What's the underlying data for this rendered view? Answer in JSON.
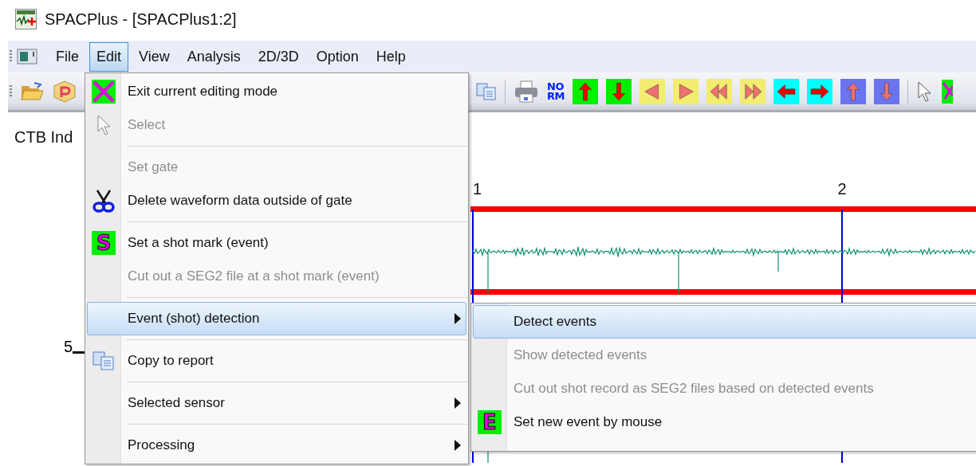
{
  "window": {
    "title": "SPACPlus - [SPACPlus1:2]"
  },
  "menu_bar": [
    {
      "label": "File",
      "selected": false
    },
    {
      "label": "Edit",
      "selected": true
    },
    {
      "label": "View",
      "selected": false
    },
    {
      "label": "Analysis",
      "selected": false
    },
    {
      "label": "2D/3D",
      "selected": false
    },
    {
      "label": "Option",
      "selected": false
    },
    {
      "label": "Help",
      "selected": false
    }
  ],
  "toolbar": {
    "norm_button_text": [
      "NO",
      "RM"
    ]
  },
  "content": {
    "heading": "CTB Ind",
    "trace_number": "5"
  },
  "plot": {
    "trace_labels": [
      "1",
      "2"
    ]
  },
  "edit_menu": [
    {
      "kind": "item",
      "label": "Exit current editing mode",
      "disabled": false,
      "selected": false,
      "has_submenu": false
    },
    {
      "kind": "item",
      "label": "Select",
      "disabled": true,
      "selected": false,
      "has_submenu": false
    },
    {
      "kind": "separator"
    },
    {
      "kind": "item",
      "label": "Set gate",
      "disabled": true,
      "selected": false,
      "has_submenu": false
    },
    {
      "kind": "item",
      "label": "Delete waveform data outside of gate",
      "disabled": false,
      "selected": false,
      "has_submenu": false
    },
    {
      "kind": "separator"
    },
    {
      "kind": "item",
      "label": "Set a shot mark (event)",
      "disabled": false,
      "selected": false,
      "has_submenu": false,
      "icon_text": "S"
    },
    {
      "kind": "item",
      "label": "Cut out a SEG2 file at a shot mark (event)",
      "disabled": true,
      "selected": false,
      "has_submenu": false
    },
    {
      "kind": "separator"
    },
    {
      "kind": "item",
      "label": "Event (shot) detection",
      "disabled": false,
      "selected": true,
      "has_submenu": true
    },
    {
      "kind": "separator"
    },
    {
      "kind": "item",
      "label": "Copy to report",
      "disabled": false,
      "selected": false,
      "has_submenu": false
    },
    {
      "kind": "separator"
    },
    {
      "kind": "item",
      "label": "Selected sensor",
      "disabled": false,
      "selected": false,
      "has_submenu": true
    },
    {
      "kind": "separator"
    },
    {
      "kind": "item",
      "label": "Processing",
      "disabled": false,
      "selected": false,
      "has_submenu": true
    }
  ],
  "submenu": [
    {
      "kind": "item",
      "label": "Detect events",
      "disabled": false,
      "selected": true,
      "has_submenu": false
    },
    {
      "kind": "item",
      "label": "Show detected events",
      "disabled": true,
      "selected": false,
      "has_submenu": false
    },
    {
      "kind": "item",
      "label": "Cut out shot record as SEG2 files based on detected events",
      "disabled": true,
      "selected": false,
      "has_submenu": false
    },
    {
      "kind": "item",
      "label": "Set new event by mouse",
      "disabled": false,
      "selected": false,
      "has_submenu": false,
      "icon_text": "E"
    }
  ]
}
